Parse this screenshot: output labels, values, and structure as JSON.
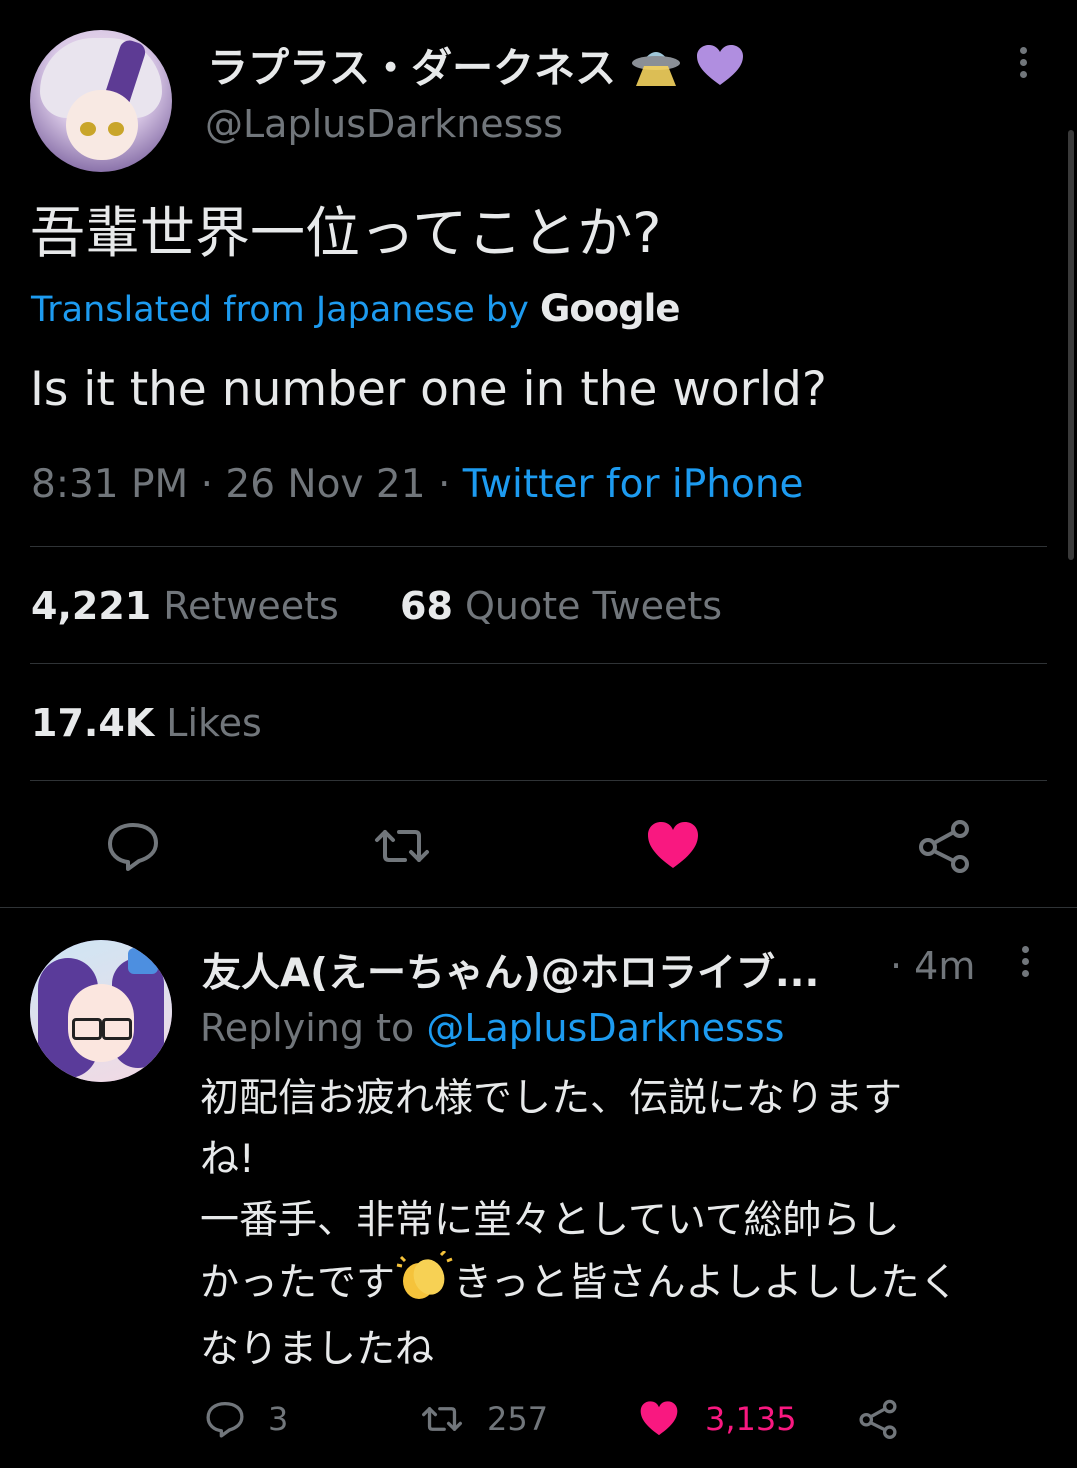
{
  "tweet": {
    "author_name": "ラプラス・ダークネス",
    "author_emojis": [
      "ufo-emoji",
      "purple-heart-emoji"
    ],
    "author_handle": "@LaplusDarknesss",
    "text": "吾輩世界一位ってことか?",
    "translated_prefix": "Translated from Japanese by",
    "translated_brand": "Google",
    "translation": "Is it the number one in the world?",
    "time": "8:31 PM",
    "date": "26 Nov 21",
    "separator": "·",
    "source": "Twitter for iPhone",
    "retweets_count": "4,221",
    "retweets_label": "Retweets",
    "quotes_count": "68",
    "quotes_label": "Quote Tweets",
    "likes_count": "17.4K",
    "likes_label": "Likes",
    "liked": true
  },
  "reply": {
    "author_name": "友人A(えーちゃん)@ホロライブ...",
    "time": "· 4m",
    "replying_prefix": "Replying to",
    "replying_to": "@LaplusDarknesss",
    "body_line1": "初配信お疲れ様でした、伝説になります",
    "body_line2": "ね!",
    "body_line3": "一番手、非常に堂々としていて総帥らし",
    "body_line4_a": "かったです",
    "body_line4_b": "きっと皆さんよしよししたく",
    "body_line5": "なりましたね",
    "reply_count": "3",
    "retweet_count": "257",
    "like_count": "3,135",
    "liked": true
  },
  "colors": {
    "background": "#000000",
    "text": "#e7e9ea",
    "muted": "#71767b",
    "accent": "#1d9bf0",
    "like": "#f91880",
    "divider": "#2f3336"
  }
}
